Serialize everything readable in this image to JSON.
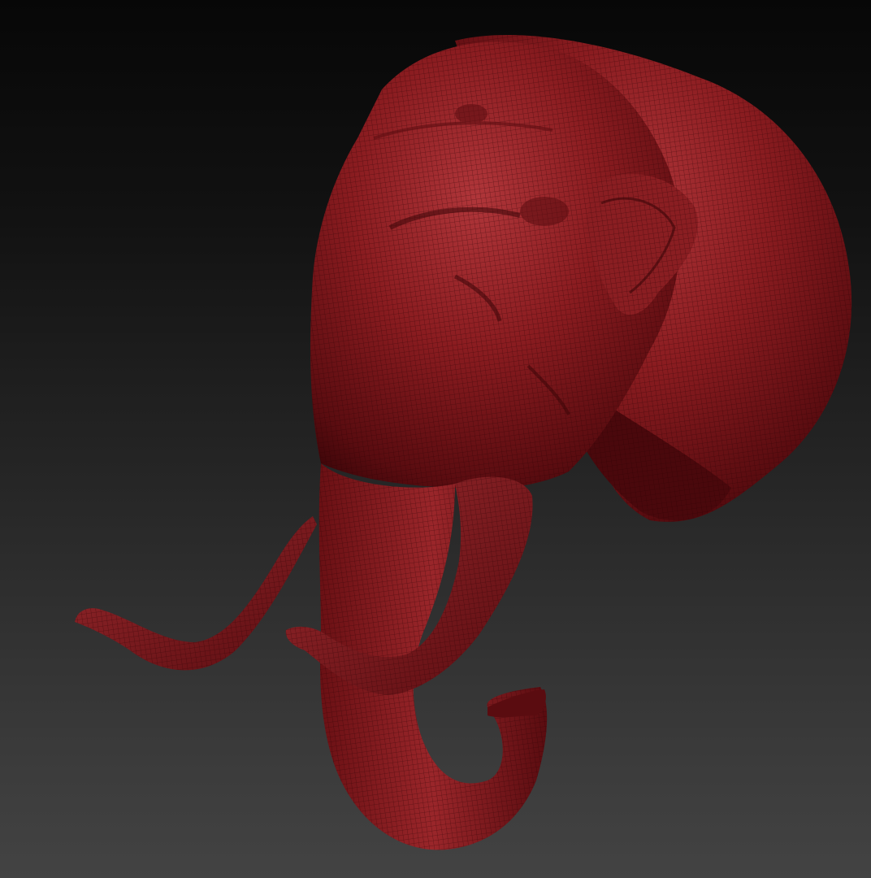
{
  "viewport": {
    "background_top": "#070707",
    "background_bottom": "#434343"
  },
  "model": {
    "subject": "elephant-head-sculpt",
    "material_color": "#7a1418",
    "highlight_color": "#a83236",
    "shadow_color": "#3a0508",
    "wireframe": true,
    "wire_color": "#2a0204"
  }
}
